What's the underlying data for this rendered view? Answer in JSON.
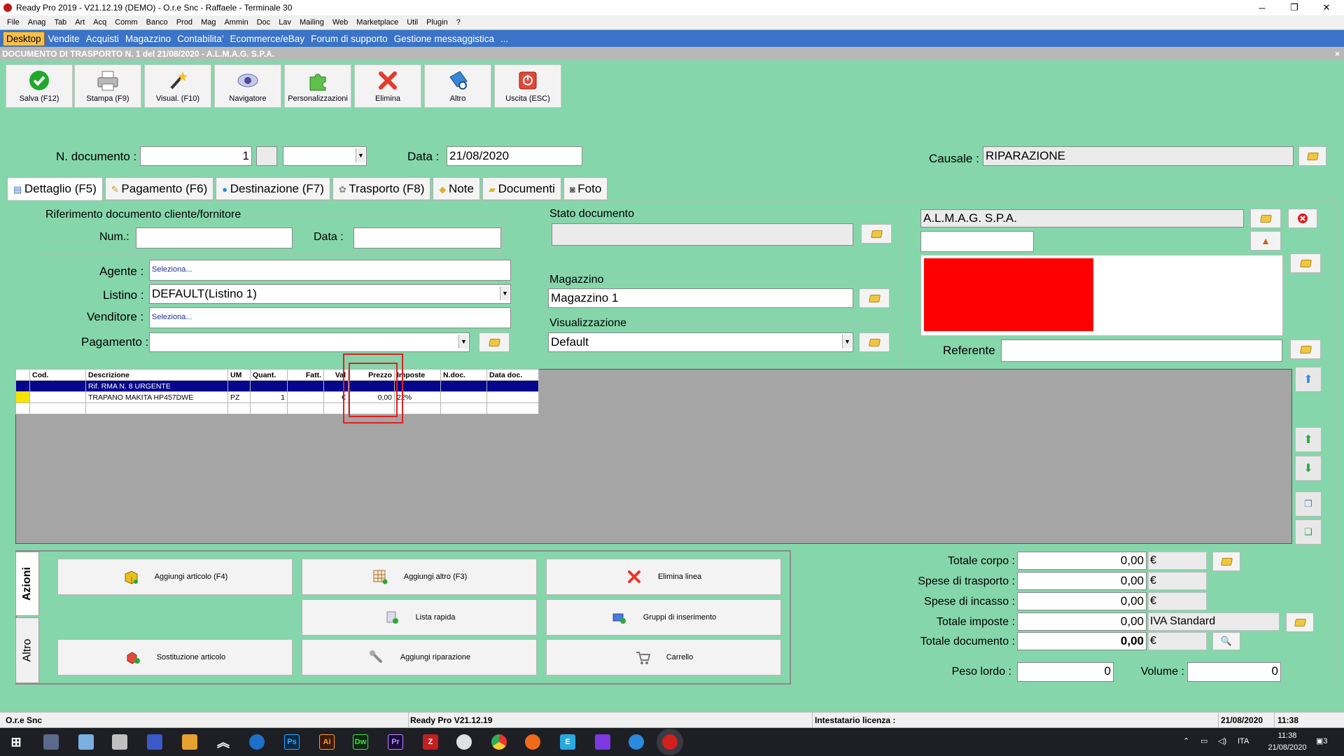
{
  "window": {
    "title": "Ready Pro 2019 - V21.12.19 (DEMO) - O.r.e Snc - Raffaele - Terminale 30",
    "minimize": "─",
    "maximize": "❐",
    "close": "✕"
  },
  "menu": [
    "File",
    "Anag",
    "Tab",
    "Art",
    "Acq",
    "Comm",
    "Banco",
    "Prod",
    "Mag",
    "Ammin",
    "Doc",
    "Lav",
    "Mailing",
    "Web",
    "Marketplace",
    "Util",
    "Plugin",
    "?"
  ],
  "modules": [
    "Desktop",
    "Vendite",
    "Acquisti",
    "Magazzino",
    "Contabilita'",
    "Ecommerce/eBay",
    "Forum di supporto",
    "Gestione messaggistica",
    "..."
  ],
  "document_title": "DOCUMENTO DI TRASPORTO N. 1 del 21/08/2020 - A.L.M.A.G. S.P.A.",
  "close_x": "×",
  "toolbar": [
    {
      "label": "Salva (F12)",
      "icon": "check-icon"
    },
    {
      "label": "Stampa (F9)",
      "icon": "printer-icon"
    },
    {
      "label": "Visual. (F10)",
      "icon": "magic-wand-icon"
    },
    {
      "label": "Navigatore",
      "icon": "navigator-icon"
    },
    {
      "label": "Personalizzazioni",
      "icon": "puzzle-icon"
    },
    {
      "label": "Elimina",
      "icon": "delete-icon"
    },
    {
      "label": "Altro",
      "icon": "more-icon"
    },
    {
      "label": "Uscita (ESC)",
      "icon": "exit-icon"
    }
  ],
  "header": {
    "ndoc_label": "N. documento :",
    "ndoc_value": "1",
    "data_label": "Data :",
    "data_value": "21/08/2020",
    "causale_label": "Causale :",
    "causale_value": "RIPARAZIONE"
  },
  "tabs": [
    "Dettaglio (F5)",
    "Pagamento (F6)",
    "Destinazione (F7)",
    "Trasporto (F8)",
    "Note",
    "Documenti",
    "Foto"
  ],
  "riferimento": {
    "title": "Riferimento documento cliente/fornitore",
    "num_label": "Num.:",
    "num_value": "",
    "data_label": "Data :",
    "data_value": ""
  },
  "agente": {
    "label": "Agente :",
    "value": "Seleziona..."
  },
  "listino": {
    "label": "Listino :",
    "value": "DEFAULT(Listino 1)"
  },
  "venditore": {
    "label": "Venditore :",
    "value": "Seleziona..."
  },
  "pagamento": {
    "label": "Pagamento :",
    "value": ""
  },
  "stato": {
    "title": "Stato documento",
    "value": ""
  },
  "magazzino": {
    "title": "Magazzino",
    "value": "Magazzino 1"
  },
  "visualizzazione": {
    "title": "Visualizzazione",
    "value": "Default"
  },
  "cliente": {
    "name": "A.L.M.A.G. S.P.A.",
    "code": "",
    "referente_label": "Referente",
    "referente_value": ""
  },
  "grid": {
    "columns": [
      "Cod.",
      "Descrizione",
      "UM",
      "Quant.",
      "Fatt.",
      "Val",
      "Prezzo",
      "Imposte",
      "N.doc.",
      "Data doc."
    ],
    "rows": [
      [
        "",
        "Rif. RMA N. 8 URGENTE",
        "",
        "",
        "",
        "",
        "",
        "",
        "",
        ""
      ],
      [
        "",
        "TRAPANO MAKITA HP457DWE",
        "PZ",
        "1",
        "",
        "€",
        "0,00",
        "22%",
        "",
        ""
      ],
      [
        "",
        "",
        "",
        "",
        "",
        "",
        "",
        "",
        "",
        ""
      ]
    ]
  },
  "actions_tabs": [
    "Azioni",
    "Altro"
  ],
  "actions": [
    {
      "label": "Aggiungi articolo (F4)",
      "icon": "box-icon"
    },
    {
      "label": "Aggiungi altro (F3)",
      "icon": "grid-add-icon"
    },
    {
      "label": "Elimina linea",
      "icon": "delete-icon"
    },
    {
      "label": "Lista rapida",
      "icon": "list-icon"
    },
    {
      "label": "Gruppi di inserimento",
      "icon": "group-icon"
    },
    {
      "label": "Sostituzione articolo",
      "icon": "swap-icon"
    },
    {
      "label": "Aggiungi riparazione",
      "icon": "wrench-icon"
    },
    {
      "label": "Carrello",
      "icon": "cart-icon"
    }
  ],
  "totals": {
    "corpo": {
      "label": "Totale corpo :",
      "value": "0,00",
      "currency": "€"
    },
    "trasporto": {
      "label": "Spese di trasporto :",
      "value": "0,00",
      "currency": "€"
    },
    "incasso": {
      "label": "Spese di incasso :",
      "value": "0,00",
      "currency": "€"
    },
    "imposte": {
      "label": "Totale imposte :",
      "value": "0,00",
      "currency": "IVA Standard"
    },
    "documento": {
      "label": "Totale documento :",
      "value": "0,00",
      "currency": "€"
    },
    "peso": {
      "label": "Peso lordo :",
      "value": "0"
    },
    "volume": {
      "label": "Volume :",
      "value": "0"
    }
  },
  "status": {
    "company": "O.r.e Snc",
    "version": "Ready Pro V21.12.19",
    "license": "Intestatario licenza :",
    "date": "21/08/2020",
    "time": "11:38"
  },
  "tray": {
    "lang": "ITA",
    "time": "11:38",
    "date": "21/08/2020",
    "notif": "3"
  },
  "colors": {
    "background": "#86d6ab",
    "module_bar": "#3a73c7",
    "selected_row": "#06068c",
    "highlight_box": "#e02020",
    "red_block": "#ff0000"
  }
}
